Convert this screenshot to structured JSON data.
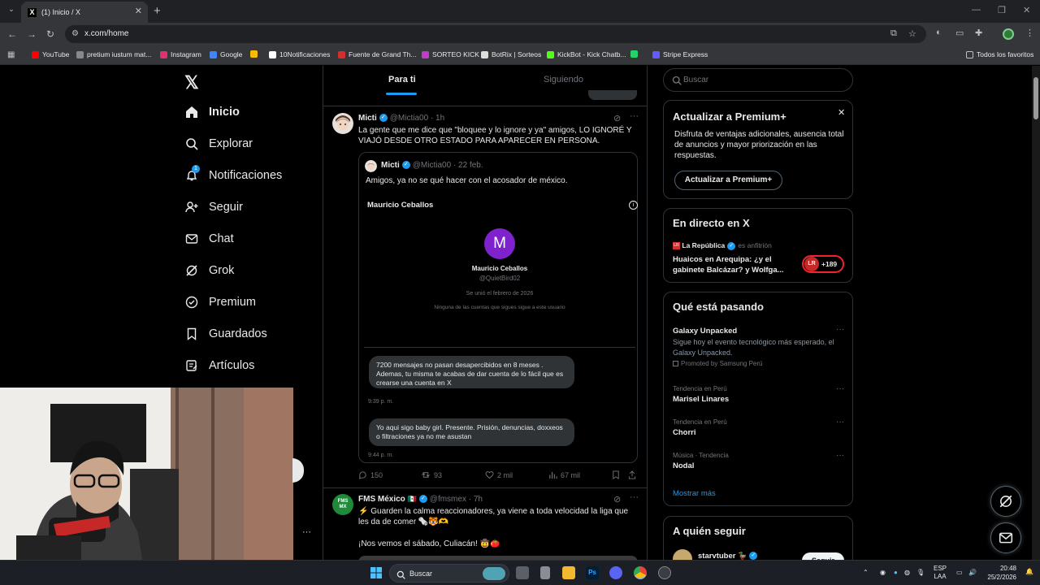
{
  "browser": {
    "tab_title": "(1) Inicio / X",
    "url": "x.com/home",
    "bookmarks": [
      {
        "label": "YouTube",
        "color": "#ff0000"
      },
      {
        "label": "pretium iustum mat...",
        "color": "#888888"
      },
      {
        "label": "Instagram",
        "color": "#e1306c"
      },
      {
        "label": "Google",
        "color": "#4285f4"
      },
      {
        "label": "",
        "color": "#fbbc05"
      },
      {
        "label": "10Notificaciones",
        "color": "#ffffff"
      },
      {
        "label": "Fuente de Grand Th...",
        "color": "#d32f2f"
      },
      {
        "label": "SORTEO KICK",
        "color": "#c03cc9"
      },
      {
        "label": "BotRix | Sorteos",
        "color": "#dddddd"
      },
      {
        "label": "KickBot - Kick Chatb...",
        "color": "#53fc18"
      },
      {
        "label": "",
        "color": "#25d366"
      },
      {
        "label": "Stripe Express",
        "color": "#635bff"
      }
    ],
    "all_bookmarks": "Todos los favoritos"
  },
  "nav": {
    "items": [
      {
        "label": "Inicio"
      },
      {
        "label": "Explorar"
      },
      {
        "label": "Notificaciones",
        "badge": "1"
      },
      {
        "label": "Seguir"
      },
      {
        "label": "Chat"
      },
      {
        "label": "Grok"
      },
      {
        "label": "Premium"
      },
      {
        "label": "Guardados"
      },
      {
        "label": "Artículos"
      }
    ],
    "more": "..."
  },
  "feed": {
    "tabs": [
      "Para ti",
      "Siguiendo"
    ],
    "tweet1": {
      "name": "Micti",
      "handle": "@Mictia00",
      "time": "· 1h",
      "text": "La gente que me dice que \"bloquee y lo ignore y ya\" amigos, LO IGNORÉ Y VIAJÓ DESDE OTRO ESTADO PARA APARECER EN PERSONA.",
      "quote": {
        "name": "Micti",
        "handle": "@Mictia00",
        "time": "· 22 feb.",
        "text": "Amigos, ya no se qué hacer con el acosador de méxico.",
        "card_header": "Mauricio Ceballos",
        "card_initial": "M",
        "card_name": "Mauricio Ceballos",
        "card_handle": "@QuietBird02",
        "card_joined": "Se unió el febrero de 2026",
        "card_followers": "Ninguna de las cuentas que sigues sigue a este usuario",
        "msg1": "7200 mensajes no pasan desapercibidos en 8 meses . Ademas, tu misma te acabas de dar cuenta de lo fácil que es crearse una cuenta en X",
        "msg1_time": "9:39 p. m.",
        "msg2": "Yo aqui sigo baby girl. Presente. Prisión, denuncias, doxxeos o filtraciones ya no me asustan",
        "msg2_time": "9:44 p. m."
      },
      "replies": "150",
      "retweets": "93",
      "likes": "2 mil",
      "views": "67 mil"
    },
    "tweet2": {
      "name": "FMS México",
      "flag": "🇲🇽",
      "handle": "@fmsmex",
      "time": "· 7h",
      "text": "⚡ Guarden la calma reaccionadores, ya viene a toda velocidad la liga que les da de comer 🗞️🐯🫶",
      "text2": "¡Nos vemos el sábado, Culiacán! 🤠🍅"
    }
  },
  "sidebar": {
    "search_placeholder": "Buscar",
    "premium": {
      "title": "Actualizar a Premium+",
      "body": "Disfruta de ventajas adicionales, ausencia total de anuncios y mayor priorización en las respuestas.",
      "button": "Actualizar a Premium+"
    },
    "live": {
      "title": "En directo en X",
      "source": "La República",
      "role": "es anfitrión",
      "headline": "Huaicos en Arequipa: ¿y el gabinete Balcázar? y Wolfga...",
      "badge_logo": "LR",
      "count": "+189"
    },
    "trends": {
      "title": "Qué está pasando",
      "items": [
        {
          "meta": "",
          "name": "Galaxy Unpacked",
          "desc": "Sigue hoy el evento tecnológico más esperado, el Galaxy Unpacked.",
          "promo": "Promoted by Samsung Perú"
        },
        {
          "meta": "Tendencia en Perú",
          "name": "Marisel Linares"
        },
        {
          "meta": "Tendencia en Perú",
          "name": "Chorri"
        },
        {
          "meta": "Música · Tendencia",
          "name": "Nodal"
        }
      ],
      "more": "Mostrar más"
    },
    "follow": {
      "title": "A quién seguir",
      "name": "starvtuber",
      "button": "Seguir"
    }
  },
  "taskbar": {
    "search": "Buscar",
    "lang": "ESP",
    "lang2": "LAA",
    "time": "20:48",
    "date": "25/2/2026"
  }
}
